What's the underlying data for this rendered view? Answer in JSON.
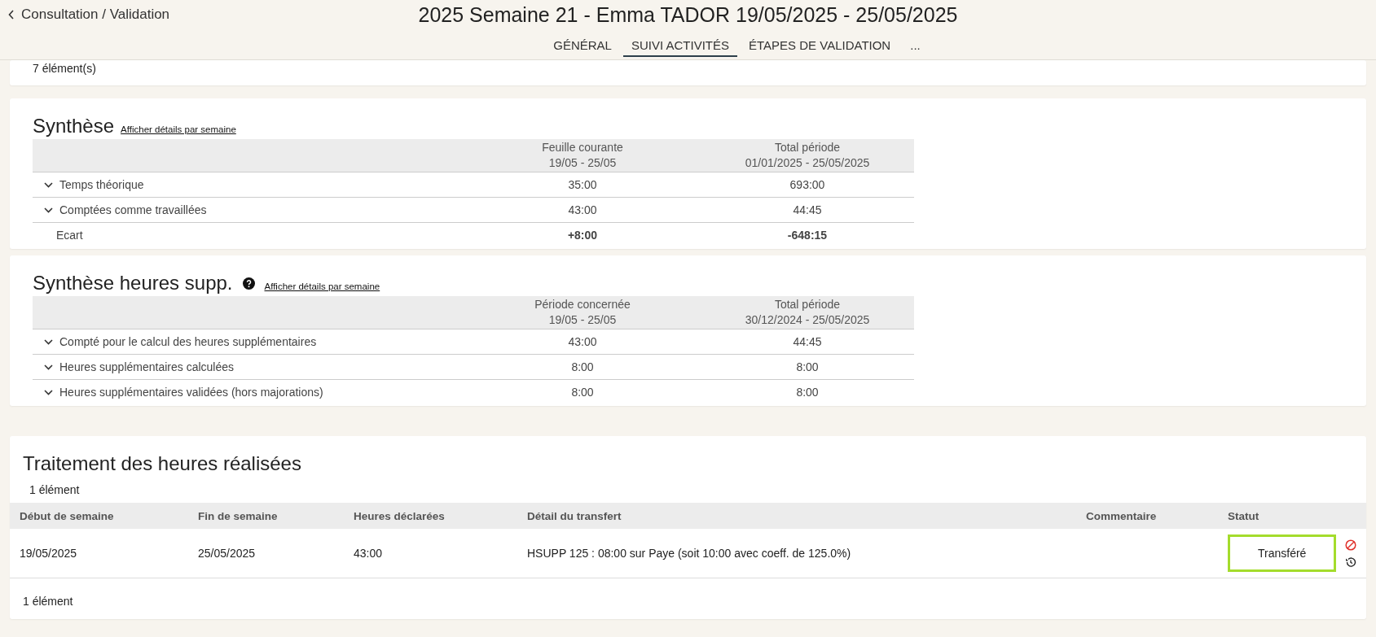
{
  "header": {
    "back_label": "Consultation / Validation",
    "title": "2025 Semaine 21 - Emma TADOR 19/05/2025 - 25/05/2025",
    "tabs": [
      {
        "label": "GÉNÉRAL",
        "selected": false
      },
      {
        "label": "SUIVI ACTIVITÉS",
        "selected": true
      },
      {
        "label": "ÉTAPES DE VALIDATION",
        "selected": false
      },
      {
        "label": "...",
        "selected": false
      }
    ]
  },
  "previous_card": {
    "count": "7 élément(s)"
  },
  "sections": [
    {
      "title": "Synthèse",
      "help": false,
      "link": "Afficher détails par semaine",
      "columns": [
        {
          "line1": "Feuille courante",
          "line2": "19/05 - 25/05"
        },
        {
          "line1": "Total période",
          "line2": "01/01/2025 - 25/05/2025"
        }
      ],
      "rows": [
        {
          "label": "Temps théorique",
          "expandable": true,
          "bold": false,
          "values": [
            "35:00",
            "693:00"
          ]
        },
        {
          "label": "Comptées comme travaillées",
          "expandable": true,
          "bold": false,
          "values": [
            "43:00",
            "44:45"
          ]
        },
        {
          "label": "Ecart",
          "expandable": false,
          "bold": true,
          "values": [
            "+8:00",
            "-648:15"
          ]
        }
      ]
    },
    {
      "title": "Synthèse heures supp.",
      "help": true,
      "link": "Afficher détails par semaine",
      "columns": [
        {
          "line1": "Période concernée",
          "line2": "19/05 - 25/05"
        },
        {
          "line1": "Total période",
          "line2": "30/12/2024 - 25/05/2025"
        }
      ],
      "rows": [
        {
          "label": "Compté pour le calcul des heures supplémentaires",
          "expandable": true,
          "bold": false,
          "values": [
            "43:00",
            "44:45"
          ]
        },
        {
          "label": "Heures supplémentaires calculées",
          "expandable": true,
          "bold": false,
          "values": [
            "8:00",
            "8:00"
          ]
        },
        {
          "label": "Heures supplémentaires validées (hors majorations)",
          "expandable": true,
          "bold": false,
          "values": [
            "8:00",
            "8:00"
          ]
        }
      ]
    }
  ],
  "treatment": {
    "title": "Traitement des heures réalisées",
    "count_top": "1 élément",
    "columns": [
      "Début de semaine",
      "Fin de semaine",
      "Heures déclarées",
      "Détail du transfert",
      "Commentaire",
      "Statut"
    ],
    "rows": [
      {
        "start": "19/05/2025",
        "end": "25/05/2025",
        "hours": "43:00",
        "detail": "HSUPP 125 : 08:00 sur Paye (soit 10:00 avec coeff. de 125.0%)",
        "status": "Transféré",
        "status_highlighted": true
      }
    ],
    "count_bottom": "1 élément"
  }
}
